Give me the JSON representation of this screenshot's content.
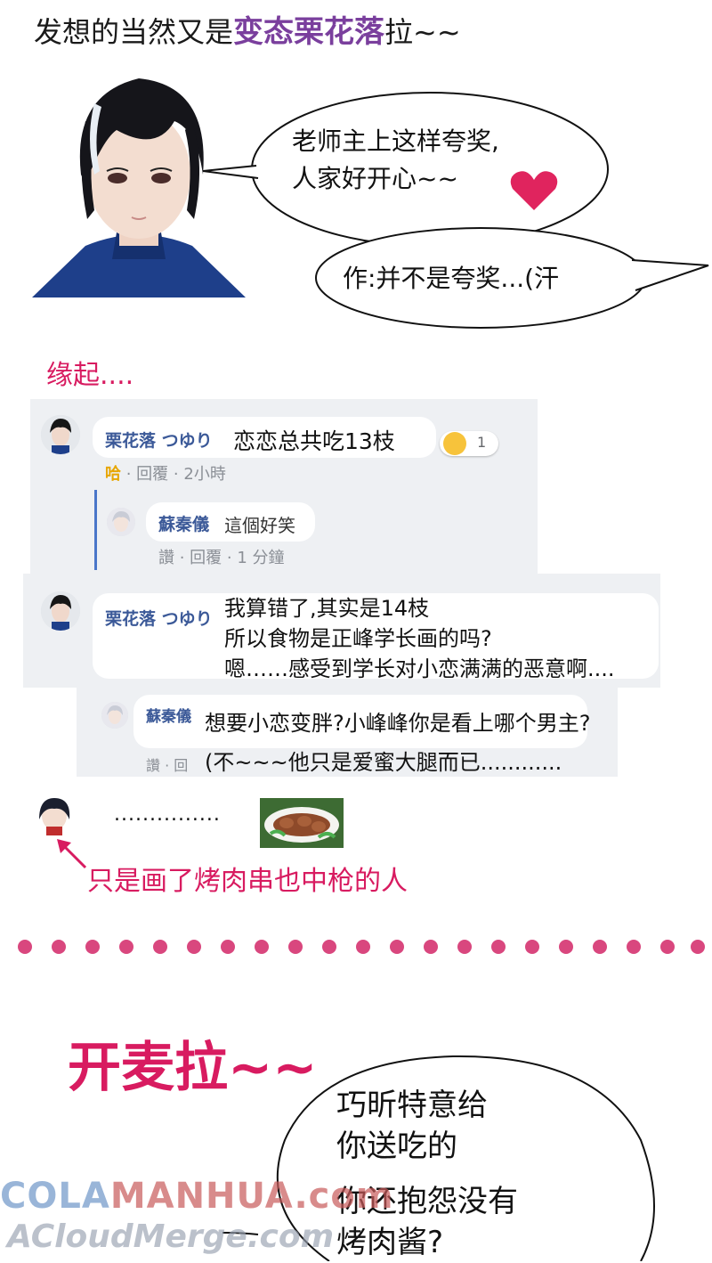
{
  "header": {
    "prefix": "发想的当然又是",
    "highlight": "变态栗花落",
    "suffix": "拉~~"
  },
  "intro_bubbles": {
    "bubble1_line1": "老师主上这样夸奖,",
    "bubble1_line2": "人家好开心~~",
    "bubble2": "作:并不是夸奖...(汗"
  },
  "section_label": "缘起....",
  "comments": {
    "c1": {
      "author": "栗花落 つゆり",
      "text": "恋恋总共吃13枝",
      "reaction_count": "1",
      "meta_reaction": "哈",
      "meta_reply": "· 回覆",
      "meta_time": "· 2小時"
    },
    "c2": {
      "author": "蘇秦儀",
      "text": "這個好笑",
      "meta_like": "讚",
      "meta_reply": "· 回覆",
      "meta_time": "· 1 分鐘"
    },
    "c3": {
      "author": "栗花落 つゆり",
      "line1": "我算错了,其实是14枝",
      "line2": "所以食物是正峰学长画的吗?",
      "line3": "嗯……感受到学长对小恋满满的恶意啊...."
    },
    "c4": {
      "author": "蘇秦儀",
      "line1": "想要小恋变胖?小峰峰你是看上哪个男主?",
      "line2": "(不~~~他只是爱蜜大腿而已............",
      "meta_like": "讚",
      "meta_reply": "· 回"
    }
  },
  "ellipsis": "...............",
  "caption": "只是画了烤肉串也中枪的人",
  "section2_title": "开麦拉~~",
  "speech2": {
    "line1": "巧昕特意给",
    "line2": "你送吃的",
    "line3": "你还抱怨没有",
    "line4": "烤肉酱?"
  },
  "watermark": {
    "part1": "COLA",
    "part2": "MANHUA",
    "part3": ".com",
    "line2": "ACloudMerge.com"
  },
  "colors": {
    "accent_pink": "#d81b60",
    "title_purple": "#7a3f9d",
    "fb_blue": "#3b5998",
    "dot_pink": "#d9477e",
    "heart": "#e0245e"
  }
}
